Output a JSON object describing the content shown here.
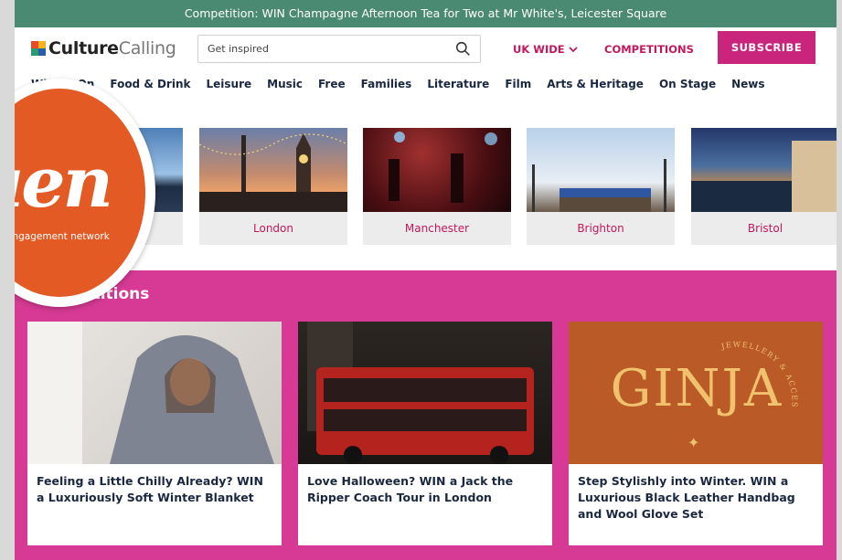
{
  "promo_bar": {
    "text": "Competition: WIN Champagne Afternoon Tea for Two at Mr White's, Leicester Square"
  },
  "header": {
    "logo_part1": "Culture",
    "logo_part2": "Calling",
    "search_placeholder": "Get inspired",
    "region_label": "UK WIDE",
    "competitions_label": "COMPETITIONS",
    "subscribe_label": "SUBSCRIBE"
  },
  "nav": {
    "items": [
      "What's On",
      "Food & Drink",
      "Leisure",
      "Music",
      "Free",
      "Families",
      "Literature",
      "Film",
      "Arts & Heritage",
      "On Stage",
      "News"
    ]
  },
  "cities": [
    {
      "name": ""
    },
    {
      "name": "London"
    },
    {
      "name": "Manchester"
    },
    {
      "name": "Brighton"
    },
    {
      "name": "Bristol"
    }
  ],
  "competitions": {
    "heading": "Competitions",
    "cards": [
      {
        "title": "Feeling a Little Chilly Already? WIN a Luxuriously Soft Winter Blanket"
      },
      {
        "title": "Love Halloween? WIN a Jack the Ripper Coach Tour in London"
      },
      {
        "title": "Step Stylishly into Winter. WIN a Luxurious Black Leather Handbag and Wool Glove Set",
        "image_text": "GINJA",
        "image_arc_text": "JEWELLERY & ACCESSORIES"
      }
    ]
  },
  "overlay_badge": {
    "word": "uen",
    "subtitle": "engagement network"
  },
  "colors": {
    "promo_bar": "#4a8a72",
    "accent": "#c2185b",
    "subscribe": "#c9257c",
    "competitions_bg": "#d63a94",
    "badge": "#e45a24"
  }
}
